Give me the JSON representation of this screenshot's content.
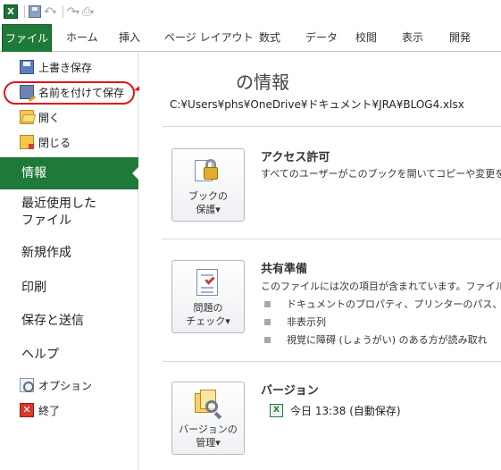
{
  "quick_access": {
    "logo_letter": "X",
    "undo_glyph": "↶",
    "redo_glyph": "↷",
    "dropdown_glyph": "▾"
  },
  "ribbon": {
    "tabs": [
      "ファイル",
      "ホーム",
      "挿入",
      "ページ レイアウト",
      "数式",
      "データ",
      "校閲",
      "表示",
      "開発"
    ]
  },
  "backstage": {
    "commands": [
      {
        "label": "上書き保存",
        "icon": "save-icon"
      },
      {
        "label": "名前を付けて保存",
        "icon": "save-as-icon"
      },
      {
        "label": "開く",
        "icon": "open-folder-icon"
      },
      {
        "label": "閉じる",
        "icon": "close-folder-icon"
      }
    ],
    "nav": {
      "info": "情報",
      "recent_line1": "最近使用した",
      "recent_line2": "ファイル",
      "new": "新規作成",
      "print": "印刷",
      "save_send": "保存と送信",
      "help": "ヘルプ"
    },
    "options": "オプション",
    "exit": "終了",
    "exit_glyph": "✕"
  },
  "info": {
    "title": "の情報",
    "path": "C:¥Users¥phs¥OneDrive¥ドキュメント¥JRA¥BLOG4.xlsx",
    "permissions": {
      "button_line1": "ブックの",
      "button_line2": "保護",
      "dropdown": "▾",
      "title": "アクセス許可",
      "text": "すべてのユーザーがこのブックを開いてコピーや変更を行"
    },
    "prepare": {
      "button_line1": "問題の",
      "button_line2": "チェック",
      "dropdown": "▾",
      "title": "共有準備",
      "text": "このファイルには次の項目が含まれています。ファイルの",
      "bullets": [
        "ドキュメントのプロパティ、プリンターのパス、作成",
        "非表示列",
        "視覚に障碍 (しょうがい) のある方が読み取れ"
      ]
    },
    "versions": {
      "button_line1": "バージョンの",
      "button_line2": "管理",
      "dropdown": "▾",
      "title": "バージョン",
      "entry": "今日 13:38 (自動保存)"
    }
  },
  "colors": {
    "file_green": "#1f7a3a",
    "annotation_red": "#e0141a"
  }
}
